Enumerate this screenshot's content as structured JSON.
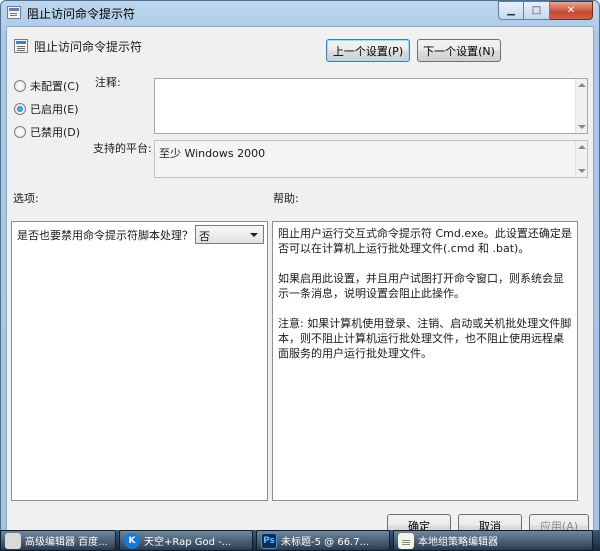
{
  "window": {
    "title": "阻止访问命令提示符",
    "icon": "policy-icon"
  },
  "header": {
    "title": "阻止访问命令提示符",
    "prev_button": "上一个设置(P)",
    "next_button": "下一个设置(N)"
  },
  "state": {
    "options": [
      {
        "label": "未配置(C)",
        "selected": false
      },
      {
        "label": "已启用(E)",
        "selected": true
      },
      {
        "label": "已禁用(D)",
        "selected": false
      }
    ]
  },
  "comment": {
    "label": "注释:",
    "value": ""
  },
  "platform": {
    "label": "支持的平台:",
    "value": "至少 Windows 2000"
  },
  "options_panel": {
    "label": "选项:",
    "item_label": "是否也要禁用命令提示符脚本处理？",
    "dropdown_value": "否"
  },
  "help_panel": {
    "label": "帮助:",
    "paragraphs": [
      "阻止用户运行交互式命令提示符 Cmd.exe。此设置还确定是否可以在计算机上运行批处理文件(.cmd 和 .bat)。",
      "如果启用此设置，并且用户试图打开命令窗口，则系统会显示一条消息，说明设置会阻止此操作。",
      "注意: 如果计算机使用登录、注销、启动或关机批处理文件脚本，则不阻止计算机运行批处理文件，也不阻止使用远程桌面服务的用户运行批处理文件。"
    ]
  },
  "footer": {
    "ok": "确定",
    "cancel": "取消",
    "apply": "应用(A)"
  },
  "taskbar": {
    "items": [
      {
        "label": "高级编辑器 百度...",
        "icon": "editor-icon"
      },
      {
        "label": "天空+Rap God -...",
        "icon": "kugou-icon",
        "glyph": "K"
      },
      {
        "label": "未标题-5 @ 66.7...",
        "icon": "photoshop-icon",
        "glyph": "Ps"
      },
      {
        "label": "本地组策略编辑器",
        "icon": "document-icon"
      }
    ]
  }
}
